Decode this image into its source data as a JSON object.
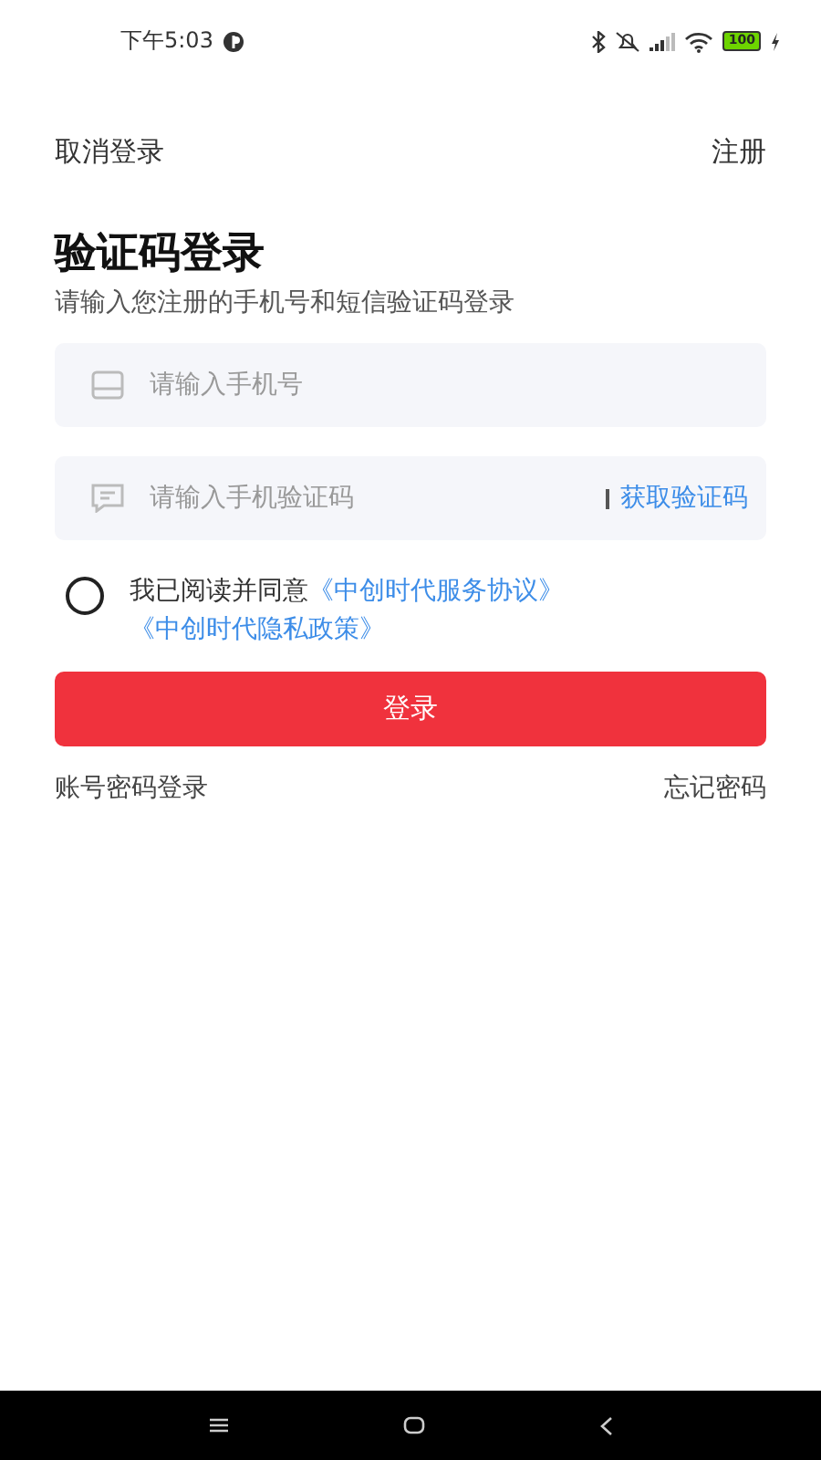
{
  "status_bar": {
    "time": "下午5:03",
    "battery": "100"
  },
  "top_bar": {
    "cancel": "取消登录",
    "register": "注册"
  },
  "title": "验证码登录",
  "subtitle": "请输入您注册的手机号和短信验证码登录",
  "fields": [
    {
      "kind": "phone",
      "placeholder": "请输入手机号"
    },
    {
      "kind": "code",
      "placeholder": "请输入手机验证码",
      "action": "获取验证码"
    }
  ],
  "agreement": {
    "checked": false,
    "text": "我已阅读并同意",
    "links": [
      "《中创时代服务协议》",
      "《中创时代隐私政策》"
    ]
  },
  "login_button": "登录",
  "bottom_links": {
    "left": "账号密码登录",
    "right": "忘记密码"
  }
}
